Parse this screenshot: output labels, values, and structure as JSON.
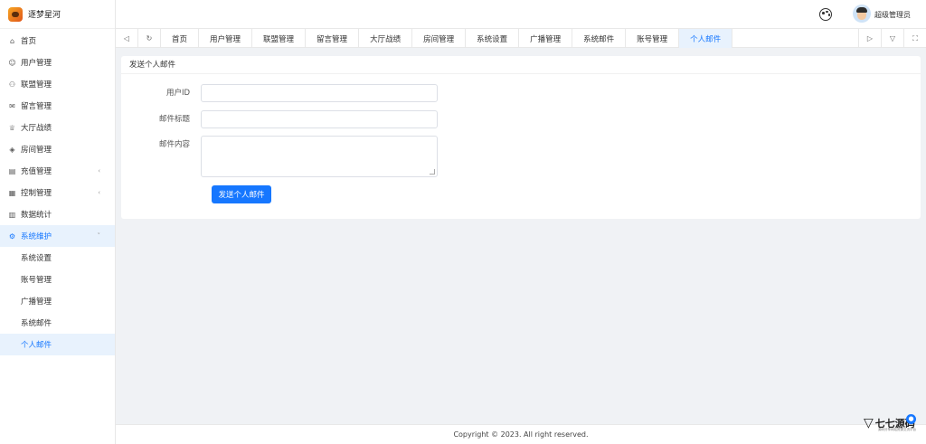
{
  "app": {
    "title": "逐梦星河"
  },
  "header": {
    "username": "超级管理员"
  },
  "sidebar": {
    "items": [
      {
        "label": "首页",
        "icon": "home-icon",
        "glyph": "⌂"
      },
      {
        "label": "用户管理",
        "icon": "user-icon",
        "glyph": "☺"
      },
      {
        "label": "联盟管理",
        "icon": "team-icon",
        "glyph": "⚇"
      },
      {
        "label": "留言管理",
        "icon": "message-icon",
        "glyph": "✉"
      },
      {
        "label": "大厅战绩",
        "icon": "trophy-icon",
        "glyph": "♕"
      },
      {
        "label": "房间管理",
        "icon": "room-icon",
        "glyph": "◈"
      },
      {
        "label": "充值管理",
        "icon": "recharge-icon",
        "glyph": "▤"
      },
      {
        "label": "控制管理",
        "icon": "control-icon",
        "glyph": "▦"
      },
      {
        "label": "数据统计",
        "icon": "chart-icon",
        "glyph": "▥"
      },
      {
        "label": "系统维护",
        "icon": "settings-icon",
        "glyph": "⚙"
      }
    ],
    "sub_items": [
      {
        "label": "系统设置"
      },
      {
        "label": "账号管理"
      },
      {
        "label": "广播管理"
      },
      {
        "label": "系统邮件"
      },
      {
        "label": "个人邮件"
      }
    ]
  },
  "tabs": [
    {
      "label": "首页"
    },
    {
      "label": "用户管理"
    },
    {
      "label": "联盟管理"
    },
    {
      "label": "留言管理"
    },
    {
      "label": "大厅战绩"
    },
    {
      "label": "房间管理"
    },
    {
      "label": "系统设置"
    },
    {
      "label": "广播管理"
    },
    {
      "label": "系统邮件"
    },
    {
      "label": "账号管理"
    },
    {
      "label": "个人邮件"
    }
  ],
  "form": {
    "title": "发送个人邮件",
    "user_id_label": "用户ID",
    "user_id_value": "",
    "subject_label": "邮件标题",
    "subject_value": "",
    "content_label": "邮件内容",
    "content_value": "",
    "submit_label": "发送个人邮件"
  },
  "footer": {
    "copyright": "Copyright © 2023. All right reserved."
  },
  "watermark": {
    "text": "七七源码",
    "sub": "源码分享网站资源交流平台"
  },
  "colors": {
    "accent": "#1677ff",
    "active_bg": "#e8f2fd"
  }
}
